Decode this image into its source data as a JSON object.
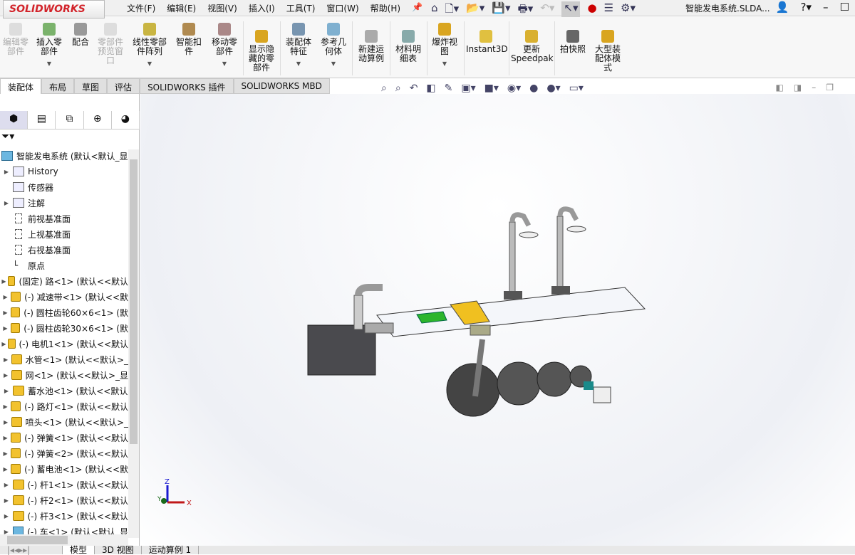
{
  "app": {
    "logo": "SOLIDWORKS",
    "document_title": "智能发电系统.SLDA..."
  },
  "menu": [
    "文件(F)",
    "编辑(E)",
    "视图(V)",
    "插入(I)",
    "工具(T)",
    "窗口(W)",
    "帮助(H)"
  ],
  "ribbon": [
    {
      "label": "编辑零部件",
      "disabled": true
    },
    {
      "label": "插入零部件",
      "disabled": false
    },
    {
      "label": "配合",
      "disabled": false
    },
    {
      "label": "零部件预览窗口",
      "disabled": true
    },
    {
      "label": "线性零部件阵列",
      "disabled": false
    },
    {
      "label": "智能扣件",
      "disabled": false
    },
    {
      "label": "移动零部件",
      "disabled": false
    },
    {
      "label": "显示隐藏的零部件",
      "disabled": false
    },
    {
      "label": "装配体特征",
      "disabled": false
    },
    {
      "label": "参考几何体",
      "disabled": false
    },
    {
      "label": "新建运动算例",
      "disabled": false
    },
    {
      "label": "材料明细表",
      "disabled": false
    },
    {
      "label": "爆炸视图",
      "disabled": false
    },
    {
      "label": "Instant3D",
      "disabled": false
    },
    {
      "label": "更新Speedpak",
      "disabled": false
    },
    {
      "label": "拍快照",
      "disabled": false
    },
    {
      "label": "大型装配体模式",
      "disabled": false
    }
  ],
  "tabs": [
    "装配体",
    "布局",
    "草图",
    "评估",
    "SOLIDWORKS 插件",
    "SOLIDWORKS MBD"
  ],
  "tree": {
    "root": "智能发电系统 (默认<默认_显",
    "items": [
      {
        "label": "History",
        "icon": "history-folder",
        "expand": true
      },
      {
        "label": "传感器",
        "icon": "sensor-folder",
        "expand": false
      },
      {
        "label": "注解",
        "icon": "annotation-folder",
        "expand": true
      },
      {
        "label": "前视基准面",
        "icon": "plane",
        "expand": false
      },
      {
        "label": "上视基准面",
        "icon": "plane",
        "expand": false
      },
      {
        "label": "右视基准面",
        "icon": "plane",
        "expand": false
      },
      {
        "label": "原点",
        "icon": "origin",
        "expand": false
      },
      {
        "label": "(固定) 路<1> (默认<<默认",
        "icon": "part",
        "expand": true
      },
      {
        "label": "(-) 减速带<1> (默认<<默",
        "icon": "part",
        "expand": true
      },
      {
        "label": "(-) 圆柱齿轮60×6<1> (默",
        "icon": "part",
        "expand": true
      },
      {
        "label": "(-) 圆柱齿轮30×6<1> (默",
        "icon": "part",
        "expand": true
      },
      {
        "label": "(-) 电机1<1> (默认<<默认",
        "icon": "part",
        "expand": true
      },
      {
        "label": "水管<1> (默认<<默认>_",
        "icon": "part",
        "expand": true
      },
      {
        "label": "网<1> (默认<<默认>_显",
        "icon": "part",
        "expand": true
      },
      {
        "label": "蓄水池<1> (默认<<默认",
        "icon": "part",
        "expand": true
      },
      {
        "label": "(-) 路灯<1> (默认<<默认",
        "icon": "part",
        "expand": true
      },
      {
        "label": "喷头<1> (默认<<默认>_",
        "icon": "part",
        "expand": true
      },
      {
        "label": "(-) 弹簧<1> (默认<<默认",
        "icon": "part",
        "expand": true
      },
      {
        "label": "(-) 弹簧<2> (默认<<默认",
        "icon": "part",
        "expand": true
      },
      {
        "label": "(-) 蓄电池<1> (默认<<默",
        "icon": "part",
        "expand": true
      },
      {
        "label": "(-) 杆1<1> (默认<<默认",
        "icon": "part",
        "expand": true
      },
      {
        "label": "(-) 杆2<1> (默认<<默认",
        "icon": "part",
        "expand": true
      },
      {
        "label": "(-) 杆3<1> (默认<<默认",
        "icon": "part",
        "expand": true
      },
      {
        "label": "(-) 车<1> (默认<默认_显",
        "icon": "assembly",
        "expand": true
      }
    ]
  },
  "bottom_tabs": [
    "模型",
    "3D 视图",
    "运动算例 1"
  ],
  "triad": {
    "x": "X",
    "y": "Y",
    "z": "Z"
  }
}
